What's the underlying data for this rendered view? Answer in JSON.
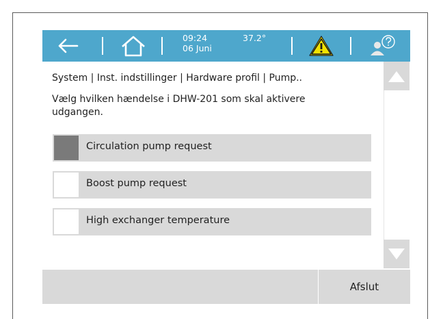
{
  "header": {
    "time": "09:24",
    "date": "06 Juni",
    "temperature": "37.2°",
    "accent_color": "#4ea7cc",
    "warning_color": "#f2e200",
    "icons": [
      "back-arrow-icon",
      "home-icon",
      "warning-icon",
      "user-help-icon"
    ]
  },
  "breadcrumb": "System | Inst. indstillinger | Hardware profil | Pump..",
  "instruction": "Vælg hvilken hændelse i DHW-201 som skal aktivere udgangen.",
  "options": [
    {
      "label": "Circulation pump request",
      "checked": true
    },
    {
      "label": "Boost pump request",
      "checked": false
    },
    {
      "label": "High exchanger temperature",
      "checked": false
    }
  ],
  "footer": {
    "exit_label": "Afslut"
  }
}
